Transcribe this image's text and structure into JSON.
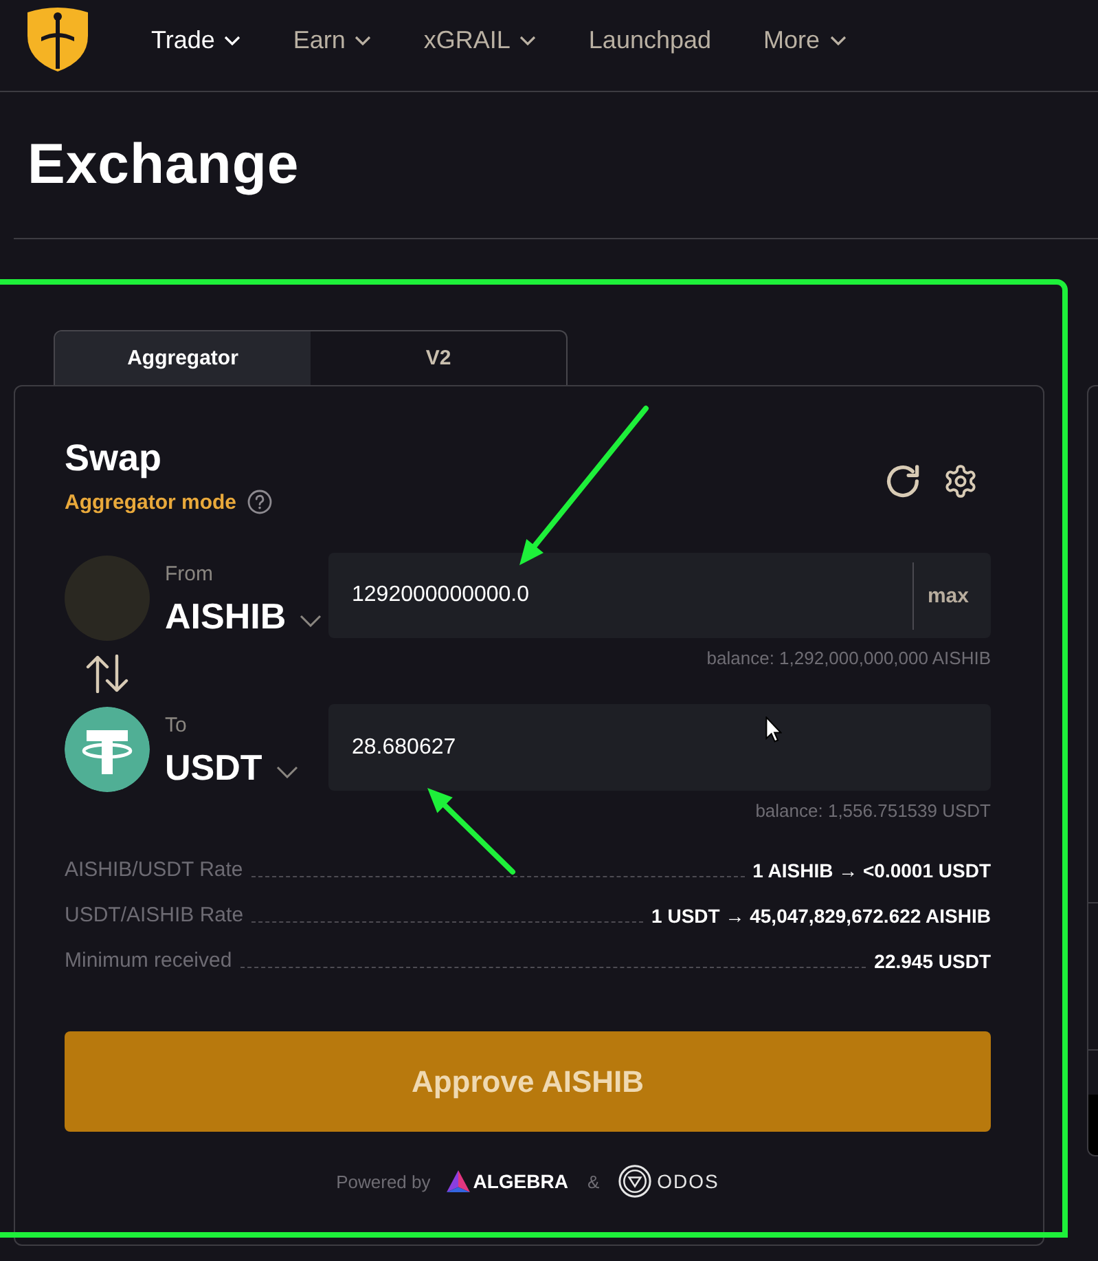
{
  "nav": {
    "items": [
      {
        "label": "Trade",
        "selected": true,
        "dropdown": true
      },
      {
        "label": "Earn",
        "selected": false,
        "dropdown": true
      },
      {
        "label": "xGRAIL",
        "selected": false,
        "dropdown": true
      },
      {
        "label": "Launchpad",
        "selected": false,
        "dropdown": false
      },
      {
        "label": "More",
        "selected": false,
        "dropdown": true
      }
    ]
  },
  "page": {
    "title": "Exchange"
  },
  "swap": {
    "tabs": [
      {
        "label": "Aggregator",
        "selected": true
      },
      {
        "label": "V2",
        "selected": false
      }
    ],
    "title": "Swap",
    "mode": "Aggregator mode",
    "from": {
      "label": "From",
      "token": "AISHIB",
      "amount": "1292000000000.0",
      "max": "max",
      "balance": "balance: 1,292,000,000,000 AISHIB"
    },
    "to": {
      "label": "To",
      "token": "USDT",
      "amount": "28.680627",
      "balance": "balance: 1,556.751539 USDT"
    },
    "details": [
      {
        "label": "AISHIB/USDT Rate",
        "value": "1 AISHIB → <0.0001 USDT"
      },
      {
        "label": "USDT/AISHIB Rate",
        "value": "1 USDT → 45,047,829,672.622 AISHIB"
      },
      {
        "label": "Minimum received",
        "value": "22.945 USDT"
      }
    ],
    "action": "Approve AISHIB",
    "powered_by": {
      "label": "Powered by",
      "separator": "&",
      "partners": [
        {
          "name": "ALGEBRA",
          "kind": "triangle"
        },
        {
          "name": "ODOS",
          "kind": "ring"
        }
      ]
    }
  }
}
